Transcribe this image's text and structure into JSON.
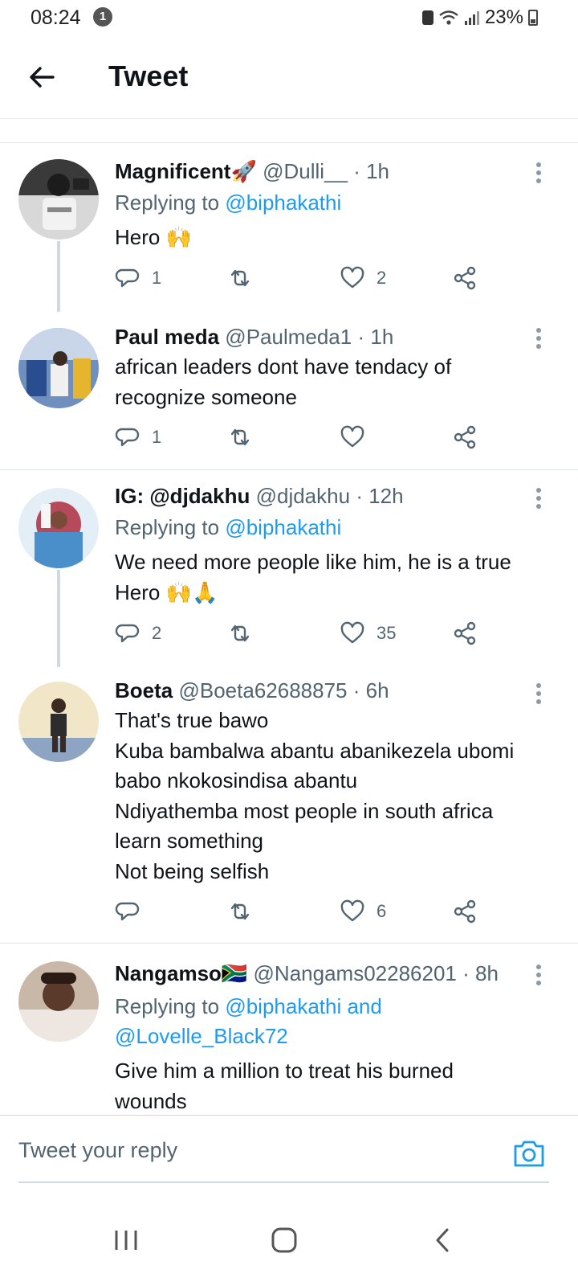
{
  "status_bar": {
    "time": "08:24",
    "notification_count": "1",
    "battery": "23%"
  },
  "header": {
    "title": "Tweet",
    "back_icon": "arrow-left-icon"
  },
  "tweets": [
    {
      "name": "Magnificent🚀",
      "handle": "@Dulli__",
      "time": "1h",
      "replying_prefix": "Replying to ",
      "replying_to": "@biphakathi",
      "body": [
        "Hero 🙌"
      ],
      "reply_count": "1",
      "retweet_count": "",
      "like_count": "2"
    },
    {
      "name": "Paul meda",
      "handle": "@Paulmeda1",
      "time": "1h",
      "body": [
        "african leaders dont have tendacy of",
        "recognize someone"
      ],
      "reply_count": "1",
      "retweet_count": "",
      "like_count": ""
    },
    {
      "name": "IG: @djdakhu",
      "handle": "@djdakhu",
      "time": "12h",
      "replying_prefix": "Replying to ",
      "replying_to": "@biphakathi",
      "body": [
        "We need more people like him, he is a true",
        "Hero 🙌🙏"
      ],
      "reply_count": "2",
      "retweet_count": "",
      "like_count": "35"
    },
    {
      "name": "Boeta",
      "handle": "@Boeta62688875",
      "time": "6h",
      "body": [
        "That's true bawo",
        "Kuba bambalwa abantu abanikezela ubomi",
        "babo nkokosindisa abantu",
        "Ndiyathemba most people in south africa",
        "learn something",
        "Not being selfish"
      ],
      "reply_count": "",
      "retweet_count": "",
      "like_count": "6"
    },
    {
      "name": "Nangamso🇿🇦",
      "handle": "@Nangams02286201",
      "time": "8h",
      "replying_prefix": "Replying to ",
      "replying_to": "@biphakathi and",
      "replying_to_2": "@Lovelle_Black72",
      "body": [
        "Give him a million to treat his burned",
        "wounds"
      ]
    }
  ],
  "reply_bar": {
    "placeholder": "Tweet your reply",
    "camera_icon": "camera-icon"
  },
  "colors": {
    "accent": "#1d9bf0",
    "secondary_text": "#536471",
    "primary_text": "#0f1419"
  }
}
